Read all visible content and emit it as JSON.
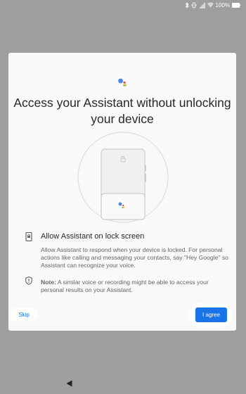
{
  "status_bar": {
    "battery_percent": "100%",
    "icons": [
      "bluetooth-icon",
      "vibrate-icon",
      "signal-icon",
      "wifi-icon",
      "battery-icon"
    ]
  },
  "dialog": {
    "title": "Access your Assistant without unlocking your device",
    "lock_section": {
      "heading": "Allow Assistant on lock screen",
      "description": "Allow Assistant to respond when your device is locked. For personal actions like calling and messaging your contacts, say \"Hey Google\" so Assistant can recognize your voice."
    },
    "note_section": {
      "label": "Note:",
      "text": " A similar voice or recording might be able to access your personal results on your Assistant."
    },
    "skip_label": "Skip",
    "agree_label": "I agree"
  },
  "colors": {
    "accent": "#1a73e8",
    "scrim": "#9e9e9e",
    "assistant_blue": "#4285f4",
    "assistant_red": "#ea4335",
    "assistant_yellow": "#fbbc04",
    "assistant_green": "#34a853"
  }
}
